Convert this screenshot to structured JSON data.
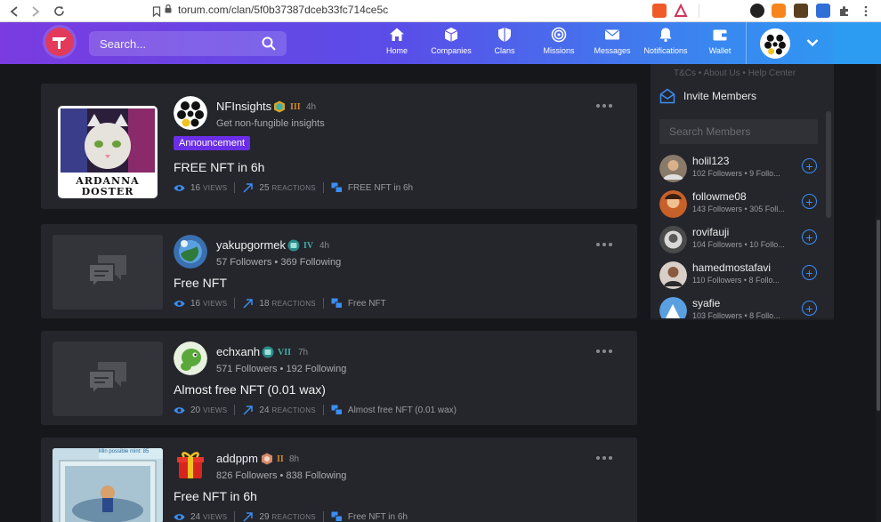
{
  "browser": {
    "url": "torum.com/clan/5f0b37387dceb33fc714ce5c"
  },
  "header": {
    "search_placeholder": "Search...",
    "nav": [
      {
        "label": "Home",
        "icon": "home-icon"
      },
      {
        "label": "Companies",
        "icon": "cube-icon"
      },
      {
        "label": "Clans",
        "icon": "shield-icon"
      },
      {
        "label": "Missions",
        "icon": "target-icon"
      },
      {
        "label": "Messages",
        "icon": "envelope-icon"
      },
      {
        "label": "Notifications",
        "icon": "bell-icon"
      },
      {
        "label": "Wallet",
        "icon": "wallet-icon"
      }
    ]
  },
  "posts": [
    {
      "username": "NFInsights",
      "rank": "III",
      "rank_color": "#d68a2a",
      "age": "4h",
      "subtitle": "Get non-fungible insights",
      "tag": "Announcement",
      "title": "FREE NFT in 6h",
      "views": "16",
      "views_label": "VIEWS",
      "reactions": "25",
      "reactions_label": "REACTIONS",
      "topic": "FREE NFT in 6h",
      "thumb_text_1": "ARDANNA",
      "thumb_text_2": "DOSTER"
    },
    {
      "username": "yakupgormek",
      "rank": "IV",
      "rank_color": "#3ab0a8",
      "age": "4h",
      "followers": "57 Followers",
      "following": "369 Following",
      "title": "Free NFT",
      "views": "16",
      "views_label": "VIEWS",
      "reactions": "18",
      "reactions_label": "REACTIONS",
      "topic": "Free NFT"
    },
    {
      "username": "echxanh",
      "rank": "VII",
      "rank_color": "#3ab0a8",
      "age": "7h",
      "followers": "571 Followers",
      "following": "192 Following",
      "title": "Almost free NFT (0.01 wax)",
      "views": "20",
      "views_label": "VIEWS",
      "reactions": "24",
      "reactions_label": "REACTIONS",
      "topic": "Almost free NFT (0.01 wax)"
    },
    {
      "username": "addppm",
      "rank": "II",
      "rank_color": "#d68a2a",
      "age": "8h",
      "followers": "826 Followers",
      "following": "838 Following",
      "title": "Free NFT in 6h",
      "views": "24",
      "views_label": "VIEWS",
      "reactions": "29",
      "reactions_label": "REACTIONS",
      "topic": "Free NFT in 6h",
      "thumb_caption": "Min possible mint: 85"
    }
  ],
  "sidebar": {
    "links": "T&Cs  •  About Us  •  Help Center",
    "invite_label": "Invite Members",
    "search_placeholder": "Search Members",
    "members": [
      {
        "name": "holil123",
        "stats": "102 Followers  •  9 Follo..."
      },
      {
        "name": "followme08",
        "stats": "143 Followers  •  305 Foll..."
      },
      {
        "name": "rovifauji",
        "stats": "104 Followers  •  10 Follo..."
      },
      {
        "name": "hamedmostafavi",
        "stats": "110 Followers  •  8 Follo..."
      },
      {
        "name": "syafie",
        "stats": "103 Followers  •  8 Follo..."
      }
    ]
  },
  "colors": {
    "accent": "#6a2ee8",
    "link_blue": "#3b8ef5",
    "card_bg": "#25262b"
  }
}
